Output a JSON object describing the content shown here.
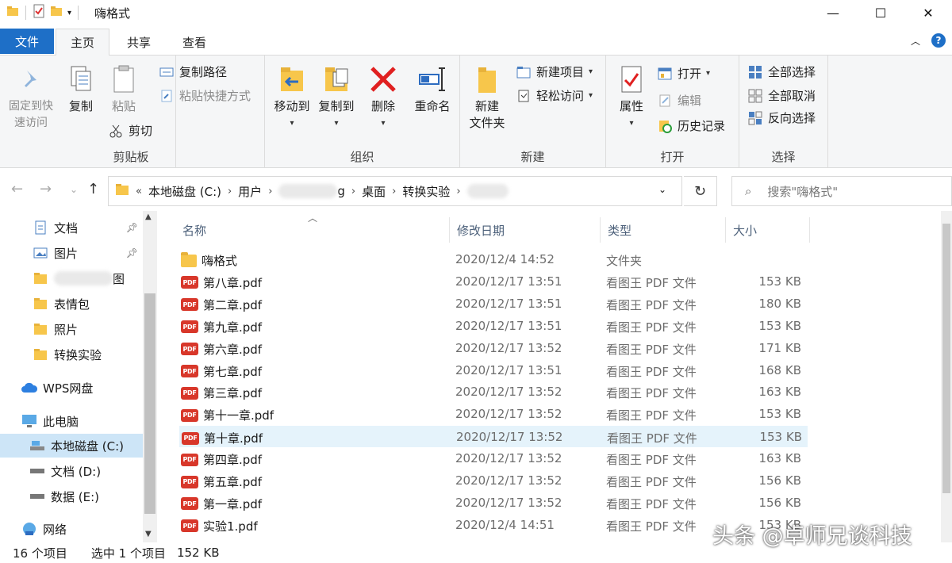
{
  "window": {
    "title": "嗨格式",
    "minimize": "—",
    "maximize": "☐",
    "close": "✕"
  },
  "tabs": {
    "file": "文件",
    "home": "主页",
    "share": "共享",
    "view": "查看"
  },
  "ribbon": {
    "clipboard": {
      "label": "剪贴板",
      "pin": "固定到快\n速访问",
      "copy": "复制",
      "paste": "粘贴",
      "copy_path": "复制路径",
      "paste_shortcut": "粘贴快捷方式",
      "cut": "剪切"
    },
    "organize": {
      "label": "组织",
      "move_to": "移动到",
      "copy_to": "复制到",
      "delete": "删除",
      "rename": "重命名"
    },
    "new": {
      "label": "新建",
      "new_folder": "新建\n文件夹",
      "new_item": "新建项目",
      "easy_access": "轻松访问"
    },
    "open": {
      "label": "打开",
      "properties": "属性",
      "open": "打开",
      "edit": "编辑",
      "history": "历史记录"
    },
    "select": {
      "label": "选择",
      "select_all": "全部选择",
      "select_none": "全部取消",
      "invert": "反向选择"
    }
  },
  "address": {
    "overflow": "«",
    "crumbs": [
      "本地磁盘 (C:)",
      "用户",
      "g",
      "桌面",
      "转换实验"
    ],
    "search_placeholder": "搜索\"嗨格式\""
  },
  "nav": {
    "items": [
      {
        "label": "文档",
        "icon": "document-icon",
        "pinned": true
      },
      {
        "label": "图片",
        "icon": "pictures-icon",
        "pinned": true
      },
      {
        "label": "图",
        "icon": "folder-icon",
        "pinned": false
      },
      {
        "label": "表情包",
        "icon": "folder-icon",
        "pinned": false
      },
      {
        "label": "照片",
        "icon": "folder-icon",
        "pinned": false
      },
      {
        "label": "转换实验",
        "icon": "folder-icon",
        "pinned": false
      },
      {
        "label": "WPS网盘",
        "icon": "cloud-icon",
        "pinned": false
      },
      {
        "label": "此电脑",
        "icon": "computer-icon",
        "pinned": false
      },
      {
        "label": "本地磁盘 (C:)",
        "icon": "drive-icon",
        "pinned": false
      },
      {
        "label": "文档 (D:)",
        "icon": "drive-icon",
        "pinned": false
      },
      {
        "label": "数据 (E:)",
        "icon": "drive-icon",
        "pinned": false
      },
      {
        "label": "网络",
        "icon": "network-icon",
        "pinned": false
      }
    ]
  },
  "columns": {
    "name": "名称",
    "date": "修改日期",
    "type": "类型",
    "size": "大小"
  },
  "files": [
    {
      "name": "嗨格式",
      "date": "2020/12/4 14:52",
      "type": "文件夹",
      "size": "",
      "kind": "folder"
    },
    {
      "name": "第八章.pdf",
      "date": "2020/12/17 13:51",
      "type": "看图王 PDF 文件",
      "size": "153 KB",
      "kind": "pdf"
    },
    {
      "name": "第二章.pdf",
      "date": "2020/12/17 13:51",
      "type": "看图王 PDF 文件",
      "size": "180 KB",
      "kind": "pdf"
    },
    {
      "name": "第九章.pdf",
      "date": "2020/12/17 13:51",
      "type": "看图王 PDF 文件",
      "size": "153 KB",
      "kind": "pdf"
    },
    {
      "name": "第六章.pdf",
      "date": "2020/12/17 13:52",
      "type": "看图王 PDF 文件",
      "size": "171 KB",
      "kind": "pdf"
    },
    {
      "name": "第七章.pdf",
      "date": "2020/12/17 13:51",
      "type": "看图王 PDF 文件",
      "size": "168 KB",
      "kind": "pdf"
    },
    {
      "name": "第三章.pdf",
      "date": "2020/12/17 13:52",
      "type": "看图王 PDF 文件",
      "size": "163 KB",
      "kind": "pdf"
    },
    {
      "name": "第十一章.pdf",
      "date": "2020/12/17 13:52",
      "type": "看图王 PDF 文件",
      "size": "153 KB",
      "kind": "pdf"
    },
    {
      "name": "第十章.pdf",
      "date": "2020/12/17 13:52",
      "type": "看图王 PDF 文件",
      "size": "153 KB",
      "kind": "pdf",
      "selected": true
    },
    {
      "name": "第四章.pdf",
      "date": "2020/12/17 13:52",
      "type": "看图王 PDF 文件",
      "size": "163 KB",
      "kind": "pdf"
    },
    {
      "name": "第五章.pdf",
      "date": "2020/12/17 13:52",
      "type": "看图王 PDF 文件",
      "size": "156 KB",
      "kind": "pdf"
    },
    {
      "name": "第一章.pdf",
      "date": "2020/12/17 13:52",
      "type": "看图王 PDF 文件",
      "size": "156 KB",
      "kind": "pdf"
    },
    {
      "name": "实验1.pdf",
      "date": "2020/12/4 14:51",
      "type": "看图王 PDF 文件",
      "size": "153 KB",
      "kind": "pdf"
    }
  ],
  "status": {
    "count": "16 个项目",
    "selected": "选中 1 个项目",
    "size": "152 KB"
  },
  "watermark": "头条 @卓师兄谈科技",
  "colors": {
    "accent": "#1e6fc7",
    "selection": "#cde5f7",
    "pdf_red": "#d8372a",
    "folder_yellow": "#f7c64b"
  }
}
